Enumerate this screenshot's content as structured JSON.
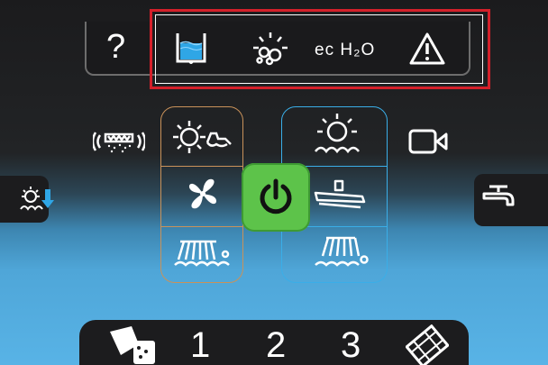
{
  "header": {
    "help_label": "?",
    "eco_label": "ec H₂O",
    "icons": [
      "water-tank-icon",
      "detergent-icon",
      "eco-h2o-icon",
      "warning-icon"
    ]
  },
  "left_side": {
    "vacuum_icon": "acoustic-vacuum-icon",
    "dosing_icon": "brush-down-icon"
  },
  "right_side": {
    "camera_icon": "camera-icon",
    "faucet_icon": "faucet-icon"
  },
  "center": {
    "power_icon": "power-icon",
    "left_group_icons": [
      "brush-scrub-icon",
      "fan-icon",
      "side-brush-icon"
    ],
    "right_group_icons": [
      "scrub-brush-icon",
      "squeegee-icon",
      "brush-deck-icon"
    ]
  },
  "bottom_tray": {
    "items": [
      {
        "label": "",
        "icon": "detergent-pour-icon"
      },
      {
        "label": "1",
        "icon": ""
      },
      {
        "label": "2",
        "icon": ""
      },
      {
        "label": "3",
        "icon": ""
      },
      {
        "label": "",
        "icon": "film-icon"
      }
    ]
  },
  "colors": {
    "highlight": "#d4202a",
    "power_bg": "#5dc34a",
    "orange_outline": "#c9925a",
    "blue_outline": "#3aaee8",
    "water_blue": "#2fa6e6"
  }
}
